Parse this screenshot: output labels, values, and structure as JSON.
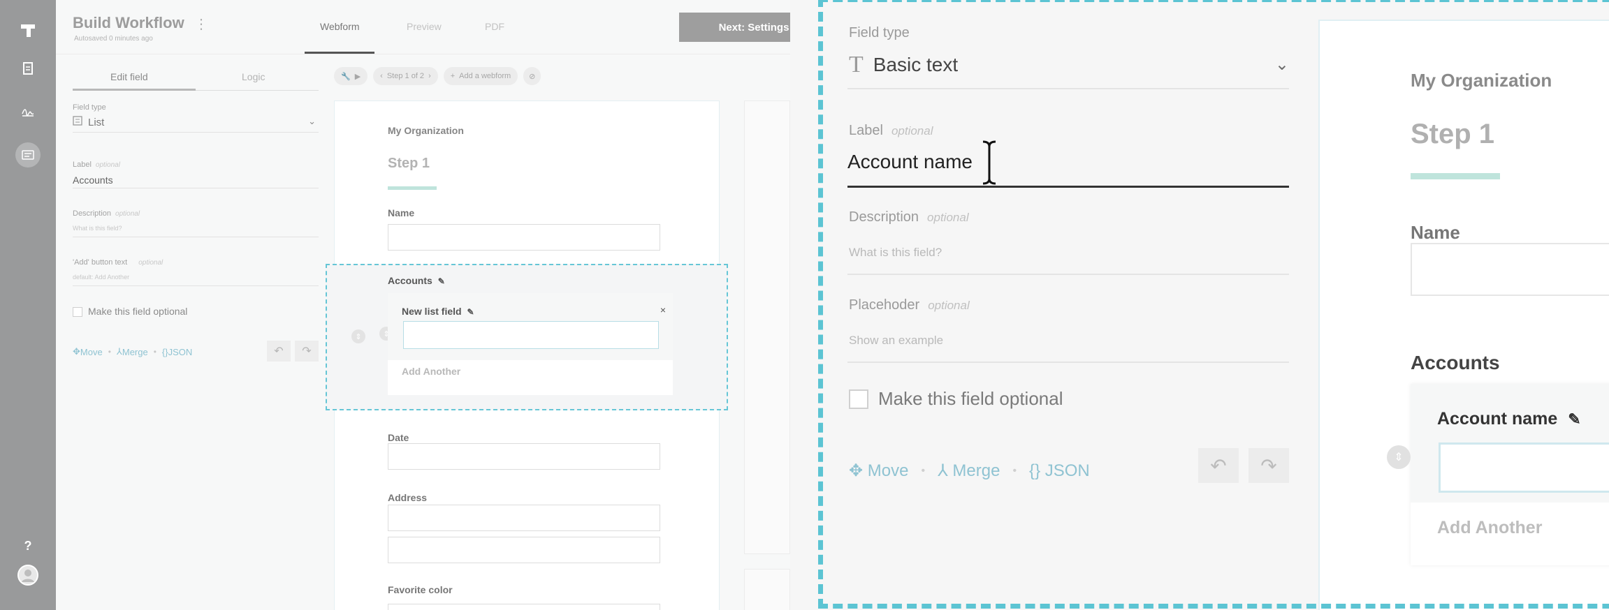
{
  "sidebar": {
    "help_label": "?"
  },
  "header": {
    "title": "Build Workflow",
    "subtitle": "Autosaved 0 minutes ago",
    "tabs": [
      {
        "label": "Webform",
        "active": true
      },
      {
        "label": "Preview",
        "active": false
      },
      {
        "label": "PDF",
        "active": false
      }
    ],
    "next_button": "Next: Settings"
  },
  "field_panel": {
    "tabs": [
      "Edit field",
      "Logic"
    ],
    "field_type_label": "Field type",
    "field_type_value": "List",
    "label_label": "Label",
    "label_optional": "optional",
    "label_value": "Accounts",
    "description_label": "Description",
    "description_optional": "optional",
    "description_placeholder": "What is this field?",
    "add_button_label": "'Add' button text",
    "add_button_optional": "optional",
    "add_button_placeholder": "default: Add Another",
    "optional_checkbox": "Make this field optional",
    "actions": {
      "move": "Move",
      "merge": "Merge",
      "json": "JSON"
    }
  },
  "toolbar": {
    "step_label": "Step 1 of 2",
    "add_webform": "Add a webform"
  },
  "form": {
    "org": "My Organization",
    "step_title": "Step 1",
    "fields": {
      "name": "Name",
      "accounts": "Accounts",
      "list_field": "New list field",
      "add_another": "Add Another",
      "date": "Date",
      "address": "Address",
      "favorite_color": "Favorite color"
    }
  },
  "zoom": {
    "field_type_label": "Field type",
    "field_type_value": "Basic text",
    "label_label": "Label",
    "label_optional": "optional",
    "label_value": "Account name",
    "description_label": "Description",
    "description_optional": "optional",
    "description_placeholder": "What is this field?",
    "placeholder_label": "Placehoder",
    "placeholder_optional": "optional",
    "placeholder_placeholder": "Show an example",
    "optional_checkbox": "Make this field optional",
    "actions": {
      "move": "Move",
      "merge": "Merge",
      "json": "JSON"
    },
    "preview": {
      "org": "My Organization",
      "step_title": "Step 1",
      "name_label": "Name",
      "accounts_label": "Accounts",
      "list_field": "Account name",
      "add_another": "Add Another"
    }
  },
  "colors": {
    "accent_teal": "#5cc4d3",
    "link_blue": "#8fc3d2",
    "step_bar": "#bfe4dc",
    "rail": "#999a9b"
  }
}
